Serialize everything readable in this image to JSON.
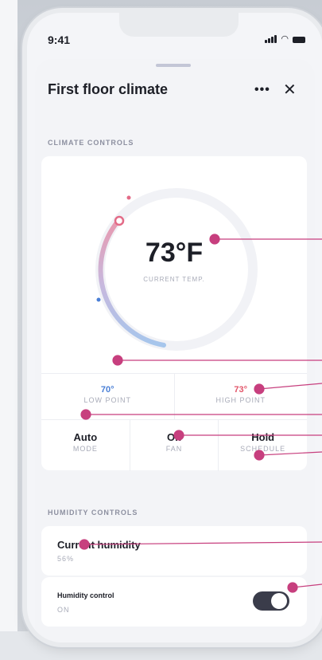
{
  "status_bar": {
    "time": "9:41"
  },
  "header": {
    "title": "First floor climate",
    "more_icon": "more-icon",
    "close_icon": "close-icon"
  },
  "climate": {
    "section_label": "CLIMATE CONTROLS",
    "current_temp": "73°F",
    "current_temp_label": "CURRENT TEMP.",
    "low_point": {
      "value": "70°",
      "label": "LOW POINT"
    },
    "high_point": {
      "value": "73°",
      "label": "HIGH POINT"
    },
    "mode": {
      "value": "Auto",
      "label": "MODE"
    },
    "fan": {
      "value": "On",
      "label": "FAN"
    },
    "schedule": {
      "value": "Hold",
      "label": "SCHEDULE"
    }
  },
  "humidity": {
    "section_label": "HUMIDITY CONTROLS",
    "current_title": "Current humidity",
    "current_value": "56%",
    "control_title": "Humidity control",
    "control_value": "ON",
    "control_on": true
  },
  "colors": {
    "accent": "#c73f7e",
    "low": "#4a7fd6",
    "high": "#e2566a",
    "toggle": "#3a3c4a"
  }
}
